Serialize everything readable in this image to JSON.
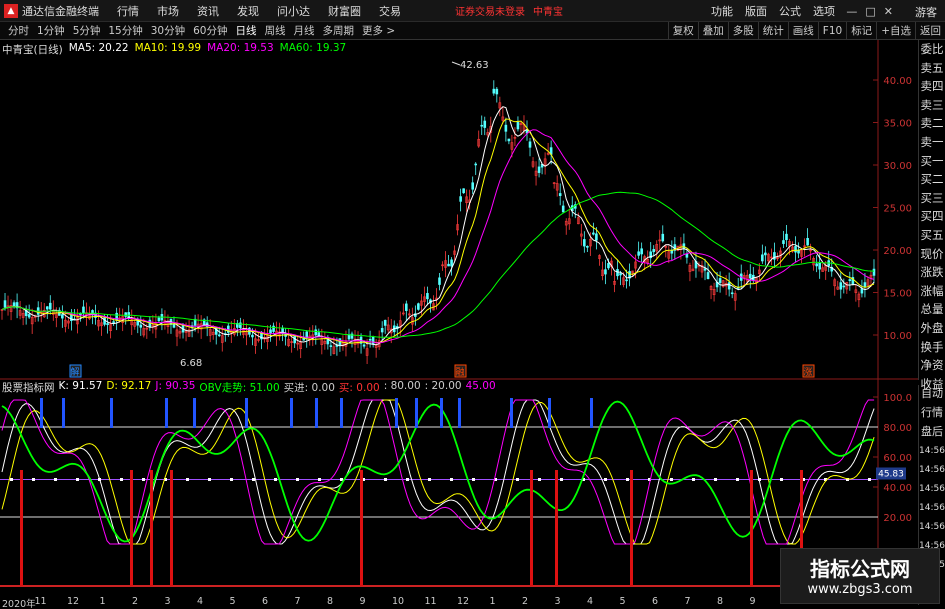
{
  "window": {
    "app_title": "通达信金融终端",
    "menus": [
      "行情",
      "市场",
      "资讯",
      "发现",
      "问小达",
      "财富圈",
      "交易"
    ],
    "login_notice": "证券交易未登录",
    "stock_name": "中青宝",
    "right_menus": [
      "功能",
      "版面",
      "公式",
      "选项"
    ],
    "window_buttons": [
      "—",
      "□",
      "✕"
    ],
    "guest": "游客"
  },
  "toolbar": {
    "periods": [
      "分时",
      "1分钟",
      "5分钟",
      "15分钟",
      "30分钟",
      "60分钟",
      "日线",
      "周线",
      "月线",
      "多周期",
      "更多 >"
    ],
    "active_period": "日线",
    "buttons": [
      "复权",
      "叠加",
      "多股",
      "统计",
      "画线",
      "F10",
      "标记",
      "+自选",
      "返回"
    ]
  },
  "price_chart": {
    "title": "中青宝(日线)",
    "ma_labels": [
      {
        "text": "MA5: 20.22",
        "color": "#ffffff"
      },
      {
        "text": "MA10: 19.99",
        "color": "#ffff00"
      },
      {
        "text": "MA20: 19.53",
        "color": "#ff00ff"
      },
      {
        "text": "MA60: 19.37",
        "color": "#00ff00"
      }
    ],
    "y_ticks": [
      "40.00",
      "35.00",
      "30.00",
      "25.00",
      "20.00",
      "15.00",
      "10.00"
    ],
    "high_label": "42.63",
    "low_label": "6.68",
    "markers": [
      {
        "text": "解",
        "color": "#2288ff"
      },
      {
        "text": "融",
        "color": "#ff4400"
      },
      {
        "text": "涨",
        "color": "#ff4400"
      }
    ]
  },
  "right_panel": {
    "items": [
      "委比",
      "卖五",
      "卖四",
      "卖三",
      "卖二",
      "卖一",
      "买一",
      "买二",
      "买三",
      "买四",
      "买五",
      "现价",
      "涨跌",
      "涨幅",
      "总量",
      "外盘",
      "换手",
      "净资",
      "收益"
    ],
    "lower_items": [
      "自动",
      "行情",
      "盘后",
      "14:56",
      "14:56",
      "14:56",
      "14:56",
      "14:56",
      "14:56",
      "14:55"
    ]
  },
  "indicator": {
    "name": "股票指标网",
    "values": [
      {
        "text": "K: 91.57",
        "color": "#ffffff"
      },
      {
        "text": "D: 92.17",
        "color": "#ffff00"
      },
      {
        "text": "J: 90.35",
        "color": "#ff00ff"
      },
      {
        "text": "OBV走势: 51.00",
        "color": "#00ff00"
      },
      {
        "text": "买进: 0.00",
        "color": "#cccccc"
      },
      {
        "text": "买: 0.00",
        "color": "#ff3333"
      },
      {
        "text": ": 80.00",
        "color": "#cccccc"
      },
      {
        "text": ": 20.00",
        "color": "#cccccc"
      },
      {
        "text": "45.00",
        "color": "#ff00ff"
      }
    ],
    "y_ticks": [
      "100.0",
      "80.00",
      "60.00",
      "40.00",
      "20.00"
    ],
    "current_value": "45.83"
  },
  "date_axis": [
    "2020年",
    "11",
    "12",
    "1",
    "2",
    "3",
    "4",
    "5",
    "6",
    "7",
    "8",
    "9",
    "10",
    "11",
    "12",
    "1",
    "2",
    "3",
    "4",
    "5",
    "6",
    "7",
    "8",
    "9"
  ],
  "watermark": {
    "cn": "指标公式网",
    "url": "www.zbgs3.com"
  }
}
